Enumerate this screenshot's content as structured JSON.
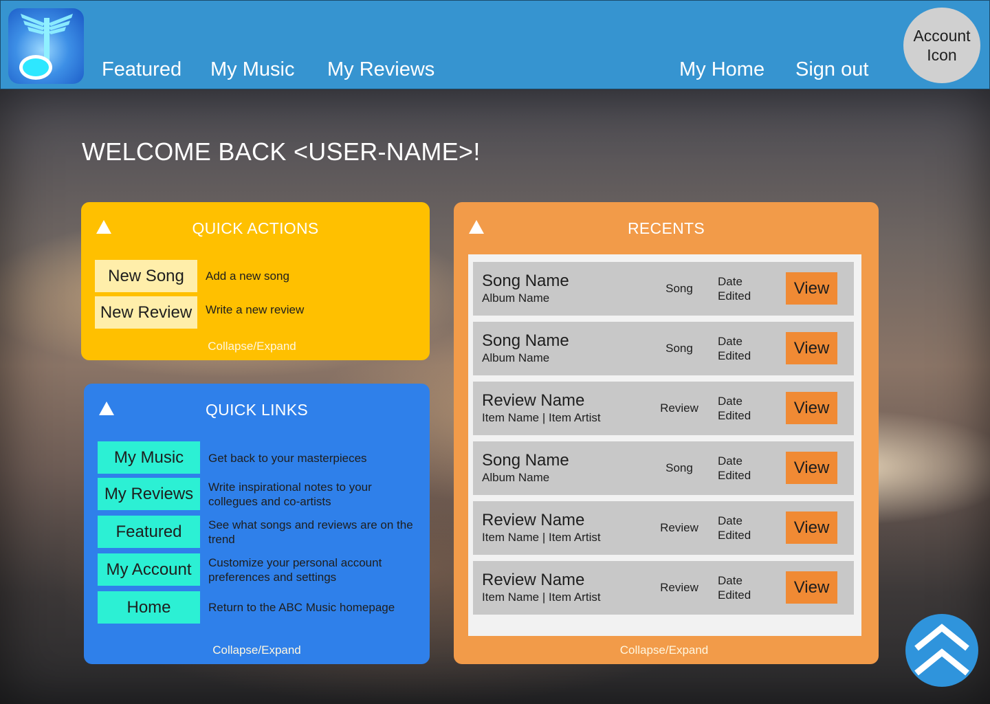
{
  "header": {
    "nav_left": [
      "Featured",
      "My Music",
      "My Reviews"
    ],
    "nav_right": [
      "My Home",
      "Sign out"
    ],
    "account_label": "Account Icon"
  },
  "welcome": "WELCOME BACK <USER-NAME>!",
  "quick_actions": {
    "title": "QUICK ACTIONS",
    "items": [
      {
        "label": "New Song",
        "desc": "Add a new song"
      },
      {
        "label": "New Review",
        "desc": "Write a new review"
      }
    ],
    "collapse": "Collapse/Expand"
  },
  "quick_links": {
    "title": "QUICK LINKS",
    "items": [
      {
        "label": "My Music",
        "desc": "Get back to your masterpieces"
      },
      {
        "label": "My Reviews",
        "desc": "Write inspirational notes to your collegues and co-artists"
      },
      {
        "label": "Featured",
        "desc": "See what songs and reviews are on the trend"
      },
      {
        "label": "My Account",
        "desc": "Customize your personal account preferences and settings"
      },
      {
        "label": "Home",
        "desc": "Return to the ABC Music homepage"
      }
    ],
    "collapse": "Collapse/Expand"
  },
  "recents": {
    "title": "RECENTS",
    "rows": [
      {
        "title": "Song Name",
        "sub": "Album Name",
        "type": "Song",
        "date": "Date Edited",
        "action": "View"
      },
      {
        "title": "Song Name",
        "sub": "Album Name",
        "type": "Song",
        "date": "Date Edited",
        "action": "View"
      },
      {
        "title": "Review Name",
        "sub": "Item Name | Item Artist",
        "type": "Review",
        "date": "Date Edited",
        "action": "View"
      },
      {
        "title": "Song Name",
        "sub": "Album Name",
        "type": "Song",
        "date": "Date Edited",
        "action": "View"
      },
      {
        "title": "Review Name",
        "sub": "Item Name | Item Artist",
        "type": "Review",
        "date": "Date Edited",
        "action": "View"
      },
      {
        "title": "Review Name",
        "sub": "Item Name | Item Artist",
        "type": "Review",
        "date": "Date Edited",
        "action": "View"
      }
    ],
    "collapse": "Collapse/Expand"
  },
  "icons": {
    "logo": "winged-music-note-logo",
    "collapse_arrow": "triangle-up-icon",
    "scroll_top": "double-chevron-up-icon"
  },
  "colors": {
    "header": "#3694d0",
    "quick_actions": "#ffc000",
    "quick_action_button": "#ffeeaa",
    "quick_links": "#2f80ea",
    "quick_link_button": "#2cf0d4",
    "recents": "#f29b49",
    "view_button": "#f08a34"
  }
}
